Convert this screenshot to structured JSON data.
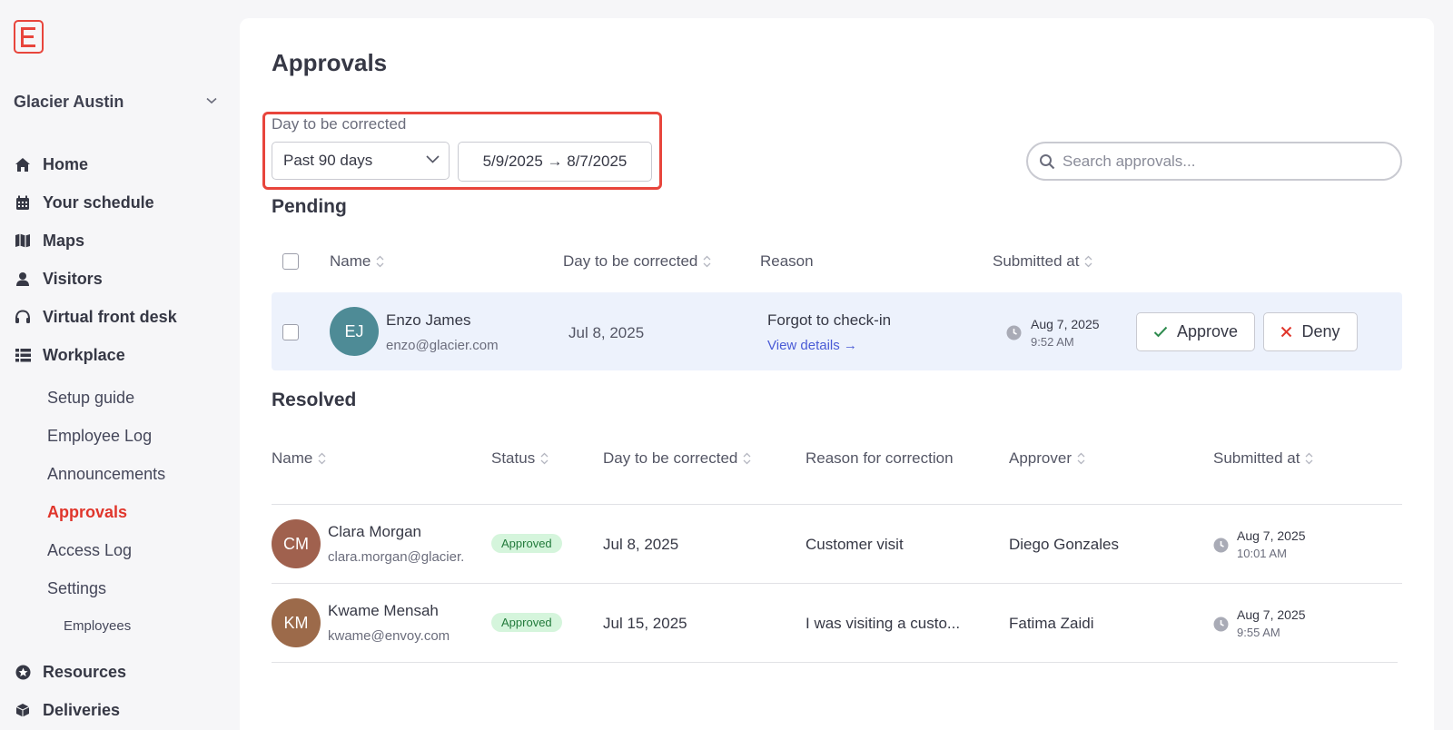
{
  "sidebar": {
    "location": "Glacier Austin",
    "nav": [
      {
        "label": "Home",
        "icon": "home-icon"
      },
      {
        "label": "Your schedule",
        "icon": "calendar-icon"
      },
      {
        "label": "Maps",
        "icon": "map-icon"
      },
      {
        "label": "Visitors",
        "icon": "visitor-icon"
      },
      {
        "label": "Virtual front desk",
        "icon": "headset-icon"
      },
      {
        "label": "Workplace",
        "icon": "list-icon"
      }
    ],
    "workplace_items": [
      "Setup guide",
      "Employee Log",
      "Announcements",
      "Approvals",
      "Access Log",
      "Settings"
    ],
    "settings_items": [
      "Employees"
    ],
    "bottom_nav": [
      {
        "label": "Resources",
        "icon": "star-icon"
      },
      {
        "label": "Deliveries",
        "icon": "package-icon"
      }
    ]
  },
  "page": {
    "title": "Approvals",
    "filter_label": "Day to be corrected",
    "range_value": "Past 90 days",
    "date_range": "5/9/2025 → 8/7/2025",
    "search_placeholder": "Search approvals..."
  },
  "pending": {
    "title": "Pending",
    "headers": {
      "name": "Name",
      "day": "Day to be corrected",
      "reason": "Reason",
      "submitted": "Submitted at"
    },
    "rows": [
      {
        "initials": "EJ",
        "name": "Enzo James",
        "email": "enzo@glacier.com",
        "day": "Jul 8, 2025",
        "reason": "Forgot to check-in",
        "details_link": "View details →",
        "submitted_date": "Aug 7, 2025",
        "submitted_time": "9:52 AM",
        "approve_label": "Approve",
        "deny_label": "Deny"
      }
    ]
  },
  "resolved": {
    "title": "Resolved",
    "headers": {
      "name": "Name",
      "status": "Status",
      "day": "Day to be corrected",
      "reason": "Reason for correction",
      "approver": "Approver",
      "submitted": "Submitted at"
    },
    "rows": [
      {
        "initials": "CM",
        "name": "Clara Morgan",
        "email": "clara.morgan@glacier.",
        "status": "Approved",
        "day": "Jul 8, 2025",
        "reason": "Customer visit",
        "approver": "Diego Gonzales",
        "submitted_date": "Aug 7, 2025",
        "submitted_time": "10:01 AM"
      },
      {
        "initials": "KM",
        "name": "Kwame Mensah",
        "email": "kwame@envoy.com",
        "status": "Approved",
        "day": "Jul 15, 2025",
        "reason": "I was visiting a custo...",
        "approver": "Fatima Zaidi",
        "submitted_date": "Aug 7, 2025",
        "submitted_time": "9:55 AM"
      }
    ]
  },
  "colors": {
    "accent": "#e8453c",
    "active_nav": "#e0362c",
    "pending_row_bg": "#edf2fc",
    "badge_bg": "#d5f5dc",
    "avatar_ej": "#4e8b96",
    "avatar_cm": "#a0614e",
    "avatar_km": "#9c6a4a"
  }
}
